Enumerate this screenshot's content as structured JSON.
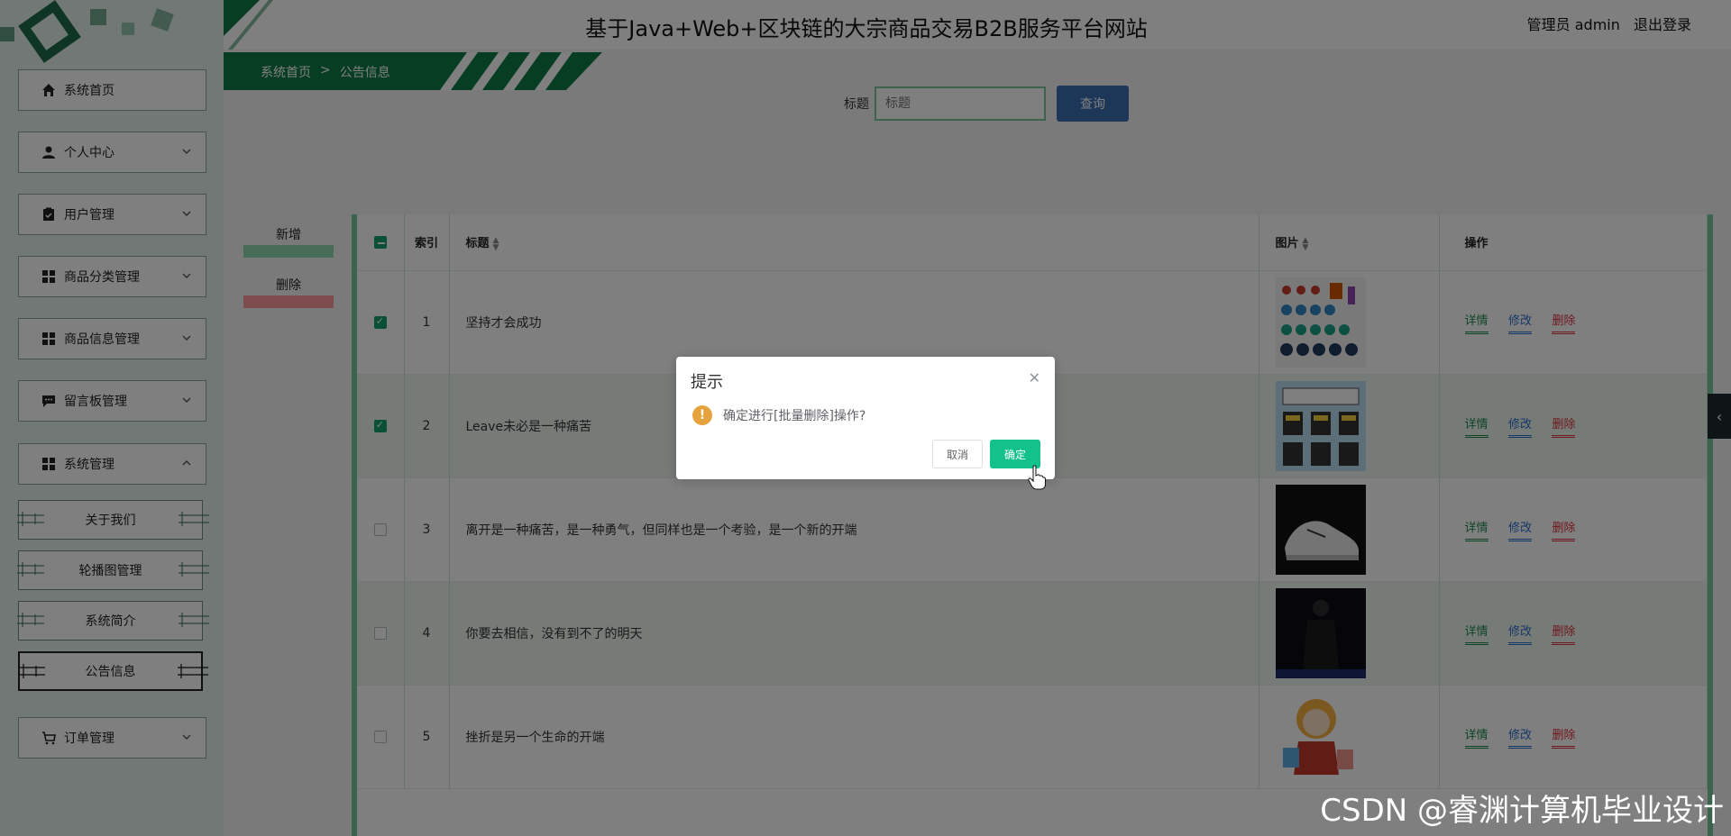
{
  "header": {
    "title": "基于Java+Web+区块链的大宗商品交易B2B服务平台网站",
    "user_label": "管理员 admin",
    "logout": "退出登录"
  },
  "breadcrumb": {
    "home": "系统首页",
    "separator": ">",
    "current": "公告信息"
  },
  "sidebar": {
    "items": [
      {
        "label": "系统首页",
        "icon": "home-icon"
      },
      {
        "label": "个人中心",
        "icon": "user-icon"
      },
      {
        "label": "用户管理",
        "icon": "clipboard-icon"
      },
      {
        "label": "商品分类管理",
        "icon": "grid-icon"
      },
      {
        "label": "商品信息管理",
        "icon": "grid-icon"
      },
      {
        "label": "留言板管理",
        "icon": "message-icon"
      },
      {
        "label": "系统管理",
        "icon": "grid-icon"
      },
      {
        "label": "订单管理",
        "icon": "cart-icon"
      }
    ],
    "sub_items": [
      {
        "label": "关于我们"
      },
      {
        "label": "轮播图管理"
      },
      {
        "label": "系统简介"
      },
      {
        "label": "公告信息"
      }
    ]
  },
  "search": {
    "label": "标题",
    "placeholder": "标题",
    "button": "查询"
  },
  "actions": {
    "add": "新增",
    "delete": "删除"
  },
  "table": {
    "headers": {
      "index": "索引",
      "title": "标题",
      "image": "图片",
      "ops": "操作"
    },
    "ops": {
      "detail": "详情",
      "edit": "修改",
      "delete": "删除"
    },
    "rows": [
      {
        "index": "1",
        "title": "坚持才会成功",
        "checked": true
      },
      {
        "index": "2",
        "title": "Leave未必是一种痛苦",
        "checked": true
      },
      {
        "index": "3",
        "title": "离开是一种痛苦，是一种勇气，但同样也是一个考验，是一个新的开端",
        "checked": false
      },
      {
        "index": "4",
        "title": "你要去相信，没有到不了的明天",
        "checked": false
      },
      {
        "index": "5",
        "title": "挫折是另一个生命的开端",
        "checked": false
      }
    ]
  },
  "dialog": {
    "title": "提示",
    "message": "确定进行[批量删除]操作?",
    "cancel": "取消",
    "confirm": "确定"
  },
  "watermark": "CSDN @睿渊计算机毕业设计",
  "colors": {
    "accent": "#13c28b",
    "brand_green": "#0e7a45",
    "warning": "#e6a23c"
  }
}
